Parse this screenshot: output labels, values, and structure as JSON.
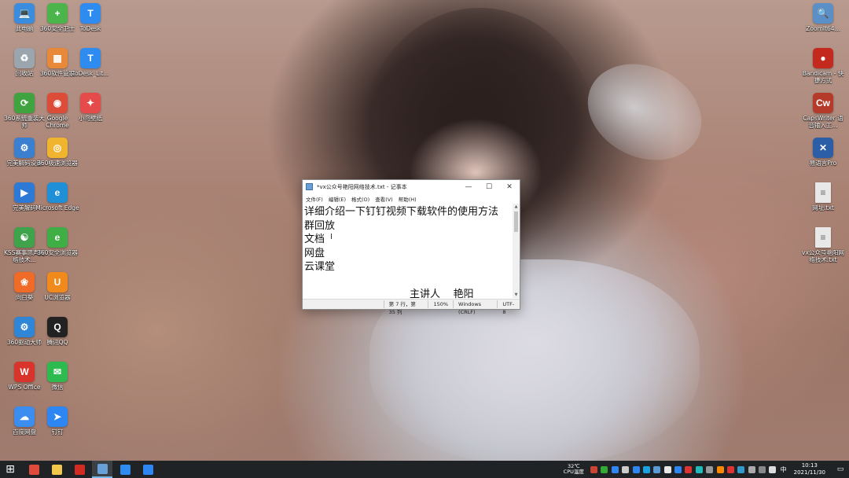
{
  "desktop_icons_left": [
    {
      "label": "此电脑",
      "glyph": "💻",
      "color": "#3a8dde",
      "col": 0,
      "row": 0
    },
    {
      "label": "360安全卫士",
      "glyph": "+",
      "color": "#4bb44a",
      "col": 1,
      "row": 0
    },
    {
      "label": "ToDesk",
      "glyph": "T",
      "color": "#2e8cf0",
      "col": 2,
      "row": 0
    },
    {
      "label": "回收站",
      "glyph": "♻",
      "color": "#9aa5ae",
      "col": 0,
      "row": 1
    },
    {
      "label": "360软件管家",
      "glyph": "▦",
      "color": "#e8893a",
      "col": 1,
      "row": 1
    },
    {
      "label": "ToDesk_Lit...",
      "glyph": "T",
      "color": "#2e8cf0",
      "col": 2,
      "row": 1
    },
    {
      "label": "360系统重装大师",
      "glyph": "⟳",
      "color": "#3fa33f",
      "col": 0,
      "row": 2
    },
    {
      "label": "Google Chrome",
      "glyph": "◉",
      "color": "#dd4b39",
      "col": 1,
      "row": 2
    },
    {
      "label": "小鸟壁纸",
      "glyph": "✦",
      "color": "#e54b4b",
      "col": 2,
      "row": 2
    },
    {
      "label": "完美解码设置",
      "glyph": "⚙",
      "color": "#3b7fd1",
      "col": 0,
      "row": 3
    },
    {
      "label": "360极速浏览器",
      "glyph": "◎",
      "color": "#f1b42f",
      "col": 1,
      "row": 3
    },
    {
      "label": "完美解码",
      "glyph": "▶",
      "color": "#2d7ad6",
      "col": 0,
      "row": 4
    },
    {
      "label": "Microsoft Edge",
      "glyph": "e",
      "color": "#1f8fd8",
      "col": 1,
      "row": 4
    },
    {
      "label": "KSS赛事思声网络技术...",
      "glyph": "☯",
      "color": "#3ea34a",
      "col": 0,
      "row": 5
    },
    {
      "label": "360安全浏览器",
      "glyph": "e",
      "color": "#3faf45",
      "col": 1,
      "row": 5
    },
    {
      "label": "向日葵",
      "glyph": "❀",
      "color": "#f06a28",
      "col": 0,
      "row": 6
    },
    {
      "label": "UC浏览器",
      "glyph": "U",
      "color": "#f08a1c",
      "col": 1,
      "row": 6
    },
    {
      "label": "360驱动大师",
      "glyph": "⚙",
      "color": "#2f86d6",
      "col": 0,
      "row": 7
    },
    {
      "label": "腾讯QQ",
      "glyph": "Q",
      "color": "#222222",
      "col": 1,
      "row": 7
    },
    {
      "label": "WPS Office",
      "glyph": "W",
      "color": "#d9342b",
      "col": 0,
      "row": 8
    },
    {
      "label": "微信",
      "glyph": "✉",
      "color": "#2dbb4f",
      "col": 1,
      "row": 8
    },
    {
      "label": "百度网盘",
      "glyph": "☁",
      "color": "#3b8df0",
      "col": 0,
      "row": 9
    },
    {
      "label": "钉钉",
      "glyph": "➤",
      "color": "#2e86f2",
      "col": 1,
      "row": 9
    }
  ],
  "desktop_icons_right": [
    {
      "label": "ZoomIt64...",
      "glyph": "🔍",
      "color": "#5a8fc8",
      "row": 0
    },
    {
      "label": "Bandicam - 快捷方式",
      "glyph": "●",
      "color": "#c4291e",
      "row": 1
    },
    {
      "label": "CapsWriter 语音输入工...",
      "glyph": "Cw",
      "color": "#b63a2a",
      "row": 2
    },
    {
      "label": "易语言Pro",
      "glyph": "✕",
      "color": "#2b5ea6",
      "row": 3
    },
    {
      "label": "网址.txt",
      "glyph": "≡",
      "color": "#e8e8e8",
      "row": 4
    },
    {
      "label": "vx公众号艳阳网络技术.txt",
      "glyph": "≡",
      "color": "#e8e8e8",
      "row": 5
    }
  ],
  "notepad": {
    "title": "*vx公众号艳阳网络技术.txt - 记事本",
    "menu": [
      "文件(F)",
      "编辑(E)",
      "格式(O)",
      "查看(V)",
      "帮助(H)"
    ],
    "lines": [
      "详细介绍一下钉钉视频下载软件的使用方法",
      "群回放",
      "文档",
      "网盘",
      "云课堂",
      "",
      ""
    ],
    "signature": "主讲人    艳阳",
    "status": {
      "position": "第 7 行，第 35 列",
      "zoom": "150%",
      "eol": "Windows (CRLF)",
      "encoding": "UTF-8"
    },
    "controls": {
      "minimize": "—",
      "maximize": "☐",
      "close": "✕"
    }
  },
  "taskbar": {
    "start_glyph": "⊞",
    "apps": [
      {
        "name": "app-360",
        "color": "#e04a3c"
      },
      {
        "name": "file-explorer",
        "color": "#f2c84b"
      },
      {
        "name": "bandicam",
        "color": "#d22b22"
      },
      {
        "name": "notepad",
        "color": "#6aa0d8",
        "active": true
      },
      {
        "name": "todesk",
        "color": "#2e8cf0"
      },
      {
        "name": "dingtalk",
        "color": "#2e86f2"
      }
    ],
    "temp": "32℃",
    "temp_label": "CPU温度",
    "ime": "中",
    "time": "10:13",
    "date": "2021/11/30",
    "tray_colors": [
      "#c43",
      "#3a3",
      "#2e86f2",
      "#ccc",
      "#2e86f2",
      "#1aa1e1",
      "#5b9bd5",
      "#e8e8e8",
      "#2e86f2",
      "#d33",
      "#2bb",
      "#999",
      "#f80",
      "#d33",
      "#39c",
      "#aaa",
      "#888",
      "#ddd"
    ]
  }
}
